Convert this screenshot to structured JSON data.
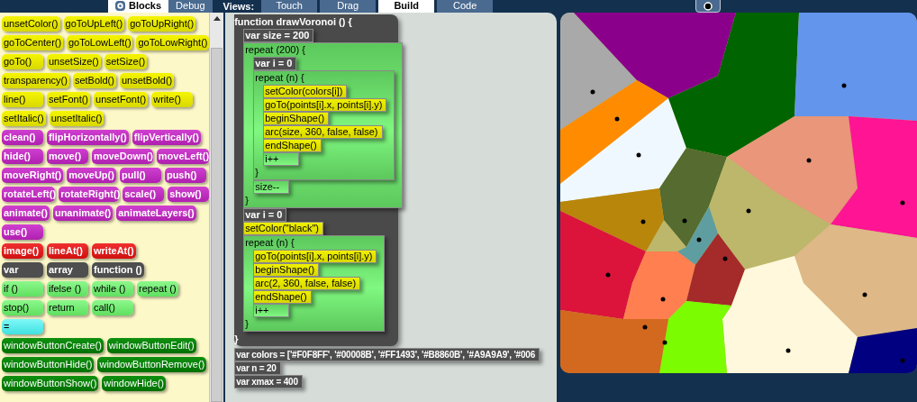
{
  "top_bar": {
    "tabs": [
      {
        "label": "Blocks",
        "selected": true,
        "icon": true
      },
      {
        "label": "Debug",
        "selected": false
      }
    ],
    "views_label": "Views:",
    "views": [
      {
        "label": "Touch",
        "selected": false
      },
      {
        "label": "Drag",
        "selected": false
      },
      {
        "label": "Build",
        "selected": true
      },
      {
        "label": "Code",
        "selected": false
      }
    ]
  },
  "palette": {
    "rows": [
      {
        "buttons": [
          {
            "label": "unsetColor()",
            "kind": "turtle"
          },
          {
            "label": "goToUpLeft()",
            "kind": "turtle"
          },
          {
            "label": "goToUpRight()",
            "kind": "turtle"
          }
        ]
      },
      {
        "buttons": [
          {
            "label": "goToCenter()",
            "kind": "turtle"
          },
          {
            "label": "goToLowLeft()",
            "kind": "turtle"
          },
          {
            "label": "goToLowRight()",
            "kind": "turtle"
          }
        ]
      },
      {
        "buttons": [
          {
            "label": "goTo()",
            "kind": "turtle"
          },
          {
            "label": "unsetSize()",
            "kind": "turtle"
          },
          {
            "label": "setSize()",
            "kind": "turtle"
          }
        ]
      },
      {
        "buttons": [
          {
            "label": "transparency()",
            "kind": "turtle"
          },
          {
            "label": "setBold()",
            "kind": "turtle"
          },
          {
            "label": "unsetBold()",
            "kind": "turtle"
          }
        ]
      },
      {
        "buttons": [
          {
            "label": "line()",
            "kind": "turtle"
          },
          {
            "label": "setFont()",
            "kind": "turtle"
          },
          {
            "label": "unsetFont()",
            "kind": "turtle"
          },
          {
            "label": "write()",
            "kind": "turtle"
          }
        ]
      },
      {
        "buttons": [
          {
            "label": "setItalic()",
            "kind": "turtle"
          },
          {
            "label": "unsetItalic()",
            "kind": "turtle"
          }
        ]
      },
      {
        "buttons": [
          {
            "label": "clean()",
            "kind": "sprite"
          },
          {
            "label": "flipHorizontally()",
            "kind": "sprite"
          },
          {
            "label": "flipVertically()",
            "kind": "sprite"
          }
        ]
      },
      {
        "buttons": [
          {
            "label": "hide()",
            "kind": "sprite"
          },
          {
            "label": "move()",
            "kind": "sprite"
          },
          {
            "label": "moveDown()",
            "kind": "sprite"
          },
          {
            "label": "moveLeft()",
            "kind": "sprite"
          }
        ]
      },
      {
        "buttons": [
          {
            "label": "moveRight()",
            "kind": "sprite"
          },
          {
            "label": "moveUp()",
            "kind": "sprite"
          },
          {
            "label": "pull()",
            "kind": "sprite"
          },
          {
            "label": "push()",
            "kind": "sprite"
          }
        ]
      },
      {
        "buttons": [
          {
            "label": "rotateLeft()",
            "kind": "sprite"
          },
          {
            "label": "rotateRight()",
            "kind": "sprite"
          },
          {
            "label": "scale()",
            "kind": "sprite"
          },
          {
            "label": "show()",
            "kind": "sprite"
          }
        ]
      },
      {
        "buttons": [
          {
            "label": "animate()",
            "kind": "sprite"
          },
          {
            "label": "unanimate()",
            "kind": "sprite"
          },
          {
            "label": "animateLayers()",
            "kind": "sprite"
          }
        ]
      },
      {
        "buttons": [
          {
            "label": "use()",
            "kind": "sprite"
          }
        ]
      },
      {
        "buttons": [
          {
            "label": "image()",
            "kind": "image"
          },
          {
            "label": "lineAt()",
            "kind": "image"
          },
          {
            "label": "writeAt()",
            "kind": "image"
          }
        ]
      },
      {
        "buttons": [
          {
            "label": "var",
            "kind": "variable"
          },
          {
            "label": "array",
            "kind": "variable"
          },
          {
            "label": "function ()",
            "kind": "variable"
          }
        ]
      },
      {
        "buttons": [
          {
            "label": "if ()",
            "kind": "control"
          },
          {
            "label": "ifelse ()",
            "kind": "control"
          },
          {
            "label": "while ()",
            "kind": "control"
          },
          {
            "label": "repeat ()",
            "kind": "control"
          }
        ]
      },
      {
        "buttons": [
          {
            "label": "stop()",
            "kind": "control"
          },
          {
            "label": "return",
            "kind": "control"
          },
          {
            "label": "call()",
            "kind": "control"
          }
        ]
      },
      {
        "buttons": [
          {
            "label": "=",
            "kind": "operator"
          }
        ]
      },
      {
        "buttons": [
          {
            "label": "windowButtonCreate()",
            "kind": "window"
          },
          {
            "label": "windowButtonEdit()",
            "kind": "window"
          }
        ]
      },
      {
        "buttons": [
          {
            "label": "windowButtonHide()",
            "kind": "window"
          },
          {
            "label": "windowButtonRemove()",
            "kind": "window"
          }
        ]
      },
      {
        "buttons": [
          {
            "label": "windowButtonShow()",
            "kind": "window"
          },
          {
            "label": "windowHide()",
            "kind": "window"
          }
        ]
      }
    ]
  },
  "code": {
    "function": {
      "header": "function drawVoronoi () {",
      "close": "}",
      "children": [
        {
          "kind": "var",
          "text": "var size = 200"
        },
        {
          "kind": "repeat",
          "text": "repeat (200) {",
          "close": "}",
          "children": [
            {
              "kind": "var",
              "text": "var i = 0"
            },
            {
              "kind": "repeat",
              "text": "repeat (n) {",
              "close": "}",
              "children": [
                {
                  "kind": "call",
                  "text": "setColor(colors[i])"
                },
                {
                  "kind": "call",
                  "text": "goTo(points[i].x, points[i].y)"
                },
                {
                  "kind": "call",
                  "text": "beginShape()"
                },
                {
                  "kind": "call",
                  "text": "arc(size, 360, false, false)"
                },
                {
                  "kind": "call",
                  "text": "endShape()"
                },
                {
                  "kind": "step",
                  "text": "i++"
                }
              ]
            },
            {
              "kind": "step",
              "text": "size--"
            }
          ]
        },
        {
          "kind": "var",
          "text": "var i = 0"
        },
        {
          "kind": "call",
          "text": "setColor(\"black\")"
        },
        {
          "kind": "repeat",
          "text": "repeat (n) {",
          "close": "}",
          "children": [
            {
              "kind": "call",
              "text": "goTo(points[i].x, points[i].y)"
            },
            {
              "kind": "call",
              "text": "beginShape()"
            },
            {
              "kind": "call",
              "text": "arc(2, 360, false, false)"
            },
            {
              "kind": "call",
              "text": "endShape()"
            },
            {
              "kind": "step",
              "text": "i++"
            }
          ]
        }
      ]
    },
    "statements": [
      {
        "kind": "var",
        "text": "var colors = ['#F0F8FF', '#00008B', '#FF1493', '#B8860B', '#A9A9A9', '#006"
      },
      {
        "kind": "var",
        "text": "var n = 20"
      },
      {
        "kind": "var",
        "text": "var xmax = 400"
      }
    ]
  }
}
